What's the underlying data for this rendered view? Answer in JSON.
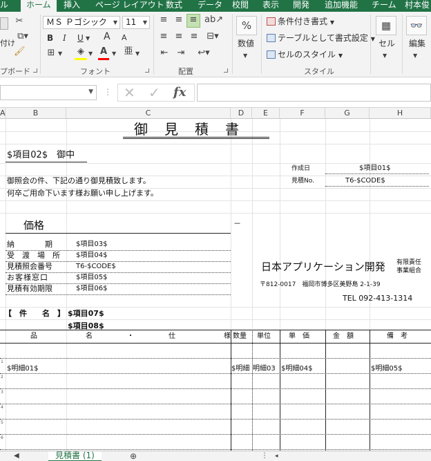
{
  "ribbon": {
    "tabs": [
      "ル",
      "ホーム",
      "挿入",
      "ページ レイアウト",
      "数式",
      "データ",
      "校閲",
      "表示",
      "開発",
      "追加機能",
      "チーム",
      "村本俊"
    ],
    "active_tab": "ホーム",
    "clipboard": {
      "paste_label": "付け",
      "group_label": "プボード"
    },
    "font": {
      "font_name": "ＭＳ Ｐゴシック",
      "font_size": "11",
      "group_label": "フォント",
      "bold": "B",
      "italic": "I",
      "underline": "U",
      "grow": "A",
      "shrink": "A",
      "fill_color": "#ffff00",
      "font_color": "#ff0000"
    },
    "alignment": {
      "group_label": "配置"
    },
    "number": {
      "label": "数値",
      "symbol": "%"
    },
    "styles": {
      "conditional": "条件付き書式",
      "table": "テーブルとして書式設定",
      "cell_styles": "セルのスタイル",
      "group_label": "スタイル"
    },
    "cells": {
      "label": "セル"
    },
    "editing": {
      "label": "編集"
    }
  },
  "formula_bar": {
    "name_box": "",
    "formula": "",
    "fx": "fx"
  },
  "columns": [
    "A",
    "B",
    "C",
    "D",
    "E",
    "F",
    "G",
    "H"
  ],
  "sheet": {
    "title": "御　見　積　書",
    "addressee": "$項目02$　御中",
    "greeting1": "御照会の件、下記の通り御見積致します。",
    "greeting2": "何卒ご用命下います様お願い申し上げます。",
    "date_label": "作成日",
    "date_value": "$項目01$",
    "estimate_no_label": "見積No.",
    "estimate_no_value": "T6-$CODE$",
    "price_label": "価格",
    "dash": "－",
    "info_rows": [
      {
        "label": "納　　　　期",
        "value": "$項目03$"
      },
      {
        "label": "受　渡　場　所",
        "value": "$項目04$"
      },
      {
        "label": "見積照会番号",
        "value": "T6-$CODE$"
      },
      {
        "label": "お客様窓口",
        "value": "$項目05$"
      },
      {
        "label": "見積有効期限",
        "value": "$項目06$"
      }
    ],
    "company_name": "日本アプリケーション開発",
    "company_type1": "有限責任",
    "company_type2": "事業組合",
    "address": "〒812-0017　福岡市博多区美野島 2-1-39",
    "tel": "TEL 092-413-1314",
    "subject_label": "【　件　　名　】",
    "subject_value1": "$項目07$",
    "subject_value2": "$項目08$",
    "table_headers": {
      "name": "品　　　　　　　名　　　　　・　　　　　仕　　　　　　　様",
      "qty": "数量",
      "unit": "単位",
      "price": "単　価",
      "amount": "金　額",
      "note": "備　考"
    },
    "detail_row": {
      "name": "$明細01$",
      "qty": "$明細",
      "unit": "明細03",
      "price": "$明細04$",
      "note": "$明細05$"
    },
    "row_numbers": [
      "1",
      "2",
      "3",
      "4",
      "5",
      "6"
    ]
  },
  "sheet_tab": "見積書 (1)"
}
